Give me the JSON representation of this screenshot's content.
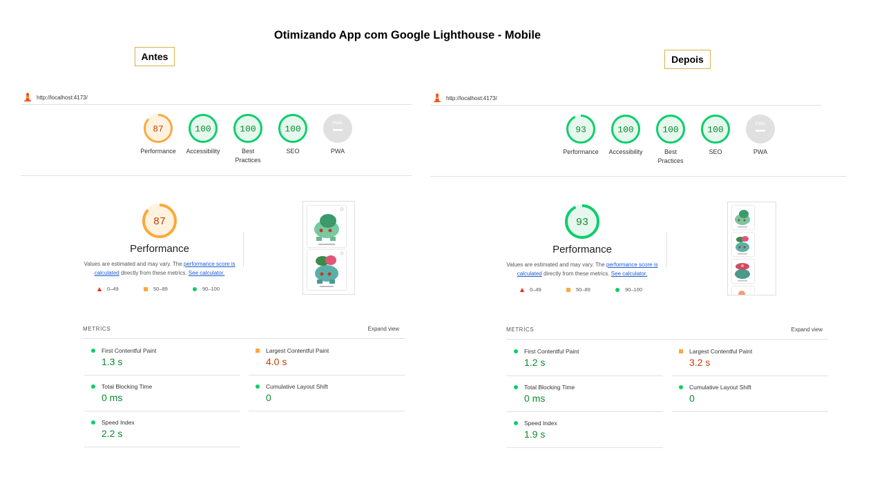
{
  "title": "Otimizando App com Google Lighthouse - Mobile",
  "labels": {
    "before": "Antes",
    "after": "Depois"
  },
  "colors": {
    "pass": "#0cce6b",
    "average": "#fba83d",
    "fail": "#e52b1a",
    "na": "#e0e0e0"
  },
  "before": {
    "url": "http://localhost:4173/",
    "categories": [
      {
        "label": "Performance",
        "score": "87",
        "status": "average"
      },
      {
        "label": "Accessibility",
        "score": "100",
        "status": "pass"
      },
      {
        "label": "Best Practices",
        "score": "100",
        "status": "pass"
      },
      {
        "label": "SEO",
        "score": "100",
        "status": "pass"
      },
      {
        "label": "PWA",
        "score": "",
        "status": "na",
        "icon": "pwa-dash-icon"
      }
    ],
    "performance": {
      "score": "87",
      "status": "average",
      "title": "Performance",
      "desc_prefix": "Values are estimated and may vary. The ",
      "desc_link1": "performance score is calculated",
      "desc_middle": " directly from these metrics. ",
      "desc_link2": "See calculator.",
      "legend": [
        "0–49",
        "50–89",
        "90–100"
      ]
    },
    "metrics_title": "METRICS",
    "expand_label": "Expand view",
    "metrics": [
      {
        "name": "First Contentful Paint",
        "value": "1.3 s",
        "status": "pass"
      },
      {
        "name": "Largest Contentful Paint",
        "value": "4.0 s",
        "status": "average"
      },
      {
        "name": "Total Blocking Time",
        "value": "0 ms",
        "status": "pass"
      },
      {
        "name": "Cumulative Layout Shift",
        "value": "0",
        "status": "pass"
      },
      {
        "name": "Speed Index",
        "value": "2.2 s",
        "status": "pass"
      }
    ]
  },
  "after": {
    "url": "http://localhost:4173/",
    "categories": [
      {
        "label": "Performance",
        "score": "93",
        "status": "pass"
      },
      {
        "label": "Accessibility",
        "score": "100",
        "status": "pass"
      },
      {
        "label": "Best Practices",
        "score": "100",
        "status": "pass"
      },
      {
        "label": "SEO",
        "score": "100",
        "status": "pass"
      },
      {
        "label": "PWA",
        "score": "",
        "status": "na",
        "icon": "pwa-dash-icon"
      }
    ],
    "performance": {
      "score": "93",
      "status": "pass",
      "title": "Performance",
      "desc_prefix": "Values are estimated and may vary. The ",
      "desc_link1": "performance score is calculated",
      "desc_middle": " directly from these metrics. ",
      "desc_link2": "See calculator.",
      "legend": [
        "0–49",
        "50–89",
        "90–100"
      ]
    },
    "metrics_title": "METRICS",
    "expand_label": "Expand view",
    "metrics": [
      {
        "name": "First Contentful Paint",
        "value": "1.2 s",
        "status": "pass"
      },
      {
        "name": "Largest Contentful Paint",
        "value": "3.2 s",
        "status": "average"
      },
      {
        "name": "Total Blocking Time",
        "value": "0 ms",
        "status": "pass"
      },
      {
        "name": "Cumulative Layout Shift",
        "value": "0",
        "status": "pass"
      },
      {
        "name": "Speed Index",
        "value": "1.9 s",
        "status": "pass"
      }
    ]
  }
}
